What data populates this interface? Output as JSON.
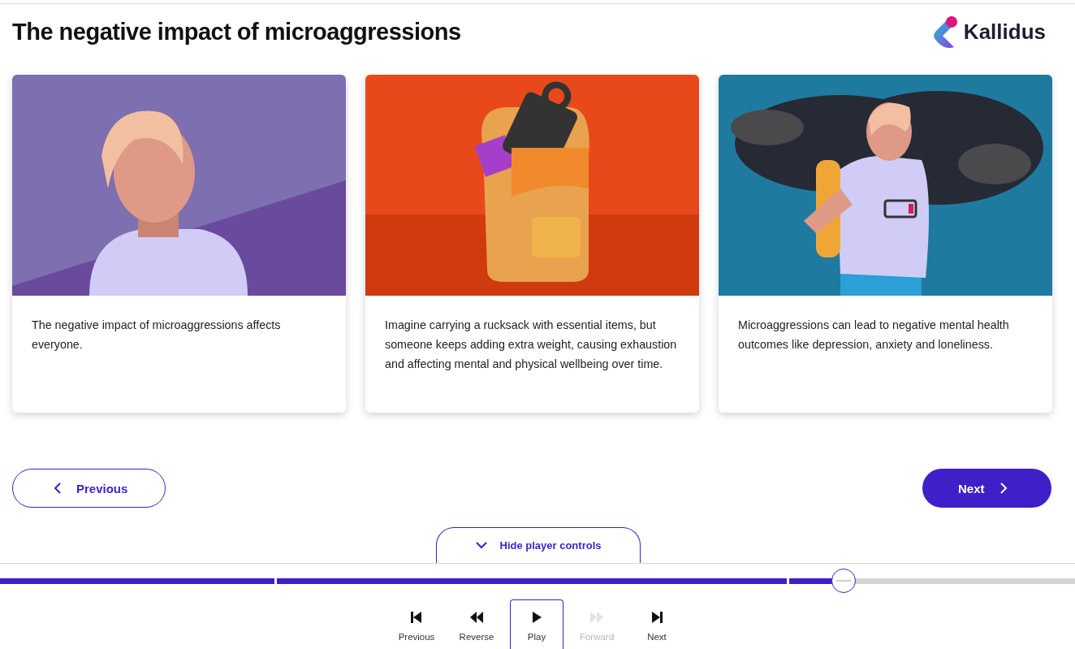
{
  "header": {
    "title": "The negative impact of microaggressions",
    "logo_text": "Kallidus"
  },
  "cards": [
    {
      "text": "The negative impact of microaggressions affects everyone."
    },
    {
      "text": "Imagine carrying a rucksack with essential items, but someone keeps adding extra weight, causing exhaustion and affecting mental and physical wellbeing over time."
    },
    {
      "text": "Microaggressions can lead to negative mental health outcomes like depression, anxiety and loneliness."
    }
  ],
  "navigation": {
    "previous": "Previous",
    "next": "Next"
  },
  "player_toggle": "Hide player controls",
  "progress": {
    "segments": [
      {
        "level": 1
      },
      {
        "level": 1
      },
      {
        "level": 0.19
      }
    ]
  },
  "player_controls": [
    {
      "kind": "first",
      "label": "Previous",
      "disabled": false,
      "selected": false
    },
    {
      "kind": "rewind",
      "label": "Reverse",
      "disabled": false,
      "selected": false
    },
    {
      "kind": "play",
      "label": "Play",
      "disabled": false,
      "selected": true
    },
    {
      "kind": "forward",
      "label": "Forward",
      "disabled": true,
      "selected": false
    },
    {
      "kind": "last",
      "label": "Next",
      "disabled": false,
      "selected": false
    }
  ]
}
